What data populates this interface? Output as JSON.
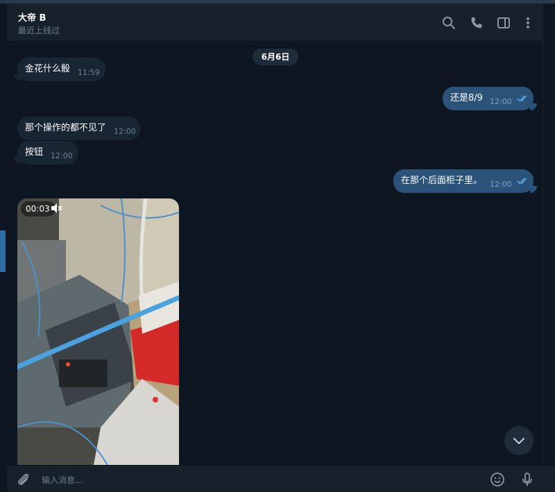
{
  "header": {
    "contact_name": "大帝 B",
    "status": "最近上线过",
    "icons": [
      "search-icon",
      "phone-icon",
      "sidebar-toggle-icon",
      "more-vertical-icon"
    ]
  },
  "date_separator": "6月6日",
  "messages": [
    {
      "direction": "in",
      "text": "金花什么骰",
      "time": "11:59"
    },
    {
      "direction": "out",
      "text": "还是8/9",
      "time": "12:00",
      "read": true
    },
    {
      "direction": "in",
      "text": "那个操作的都不见了",
      "time": "12:00"
    },
    {
      "direction": "in",
      "text": "按钮",
      "time": "12:00"
    },
    {
      "direction": "out",
      "text": "在那个后面柜子里。",
      "time": "12:00",
      "read": true
    }
  ],
  "video": {
    "duration": "00:03",
    "muted": true
  },
  "composer": {
    "placeholder": "输入消息..."
  },
  "colors": {
    "background": "#0e1621",
    "incoming_bubble": "#182533",
    "outgoing_bubble": "#2b5278",
    "accent": "#5ba8e6"
  }
}
